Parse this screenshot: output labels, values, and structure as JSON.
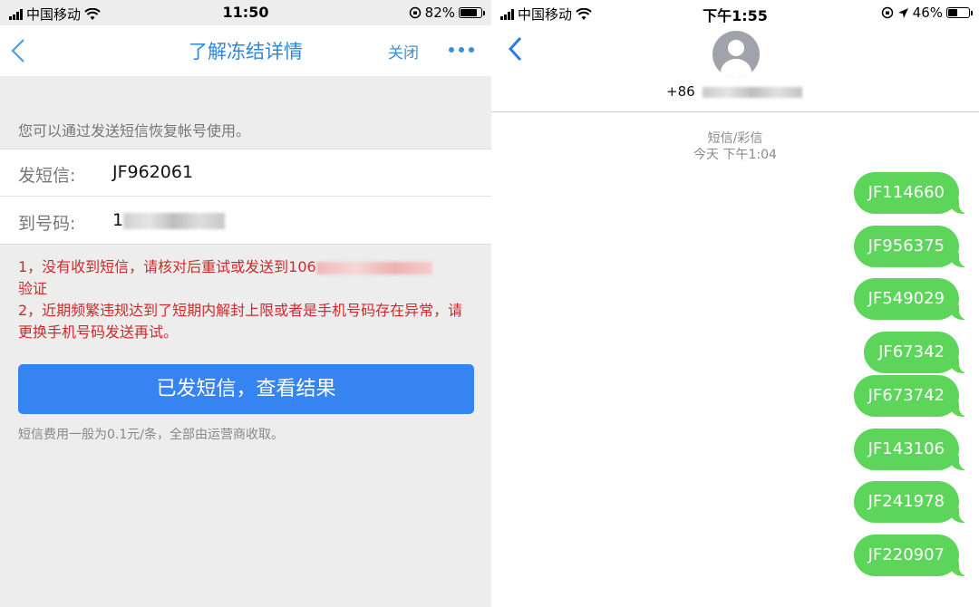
{
  "left": {
    "status": {
      "carrier": "中国移动",
      "time": "11:50",
      "battery": "82%"
    },
    "nav": {
      "title": "了解冻结详情",
      "close": "关闭"
    },
    "hint": "您可以通过发送短信恢复帐号使用。",
    "send_label": "发短信:",
    "send_value": "JF962061",
    "to_label": "到号码:",
    "to_value": "1",
    "warn_line1": "1，没有收到短信，请核对后重试或发送到106",
    "warn_line2": "验证",
    "warn_line3": "2，近期频繁违规达到了短期内解封上限或者是手机号码存在异常，请更换手机号码发送再试。",
    "button": "已发短信，查看结果",
    "fee_note": "短信费用一般为0.1元/条，全部由运营商收取。"
  },
  "right": {
    "status": {
      "carrier": "中国移动",
      "time": "下午1:55",
      "battery": "46%"
    },
    "phone_prefix": "+86",
    "msg_type": "短信/彩信",
    "msg_time": "今天 下午1:04",
    "messages": [
      "JF114660",
      "JF956375",
      "JF549029",
      "JF67342",
      "JF673742",
      "JF143106",
      "JF241978",
      "JF220907"
    ]
  }
}
